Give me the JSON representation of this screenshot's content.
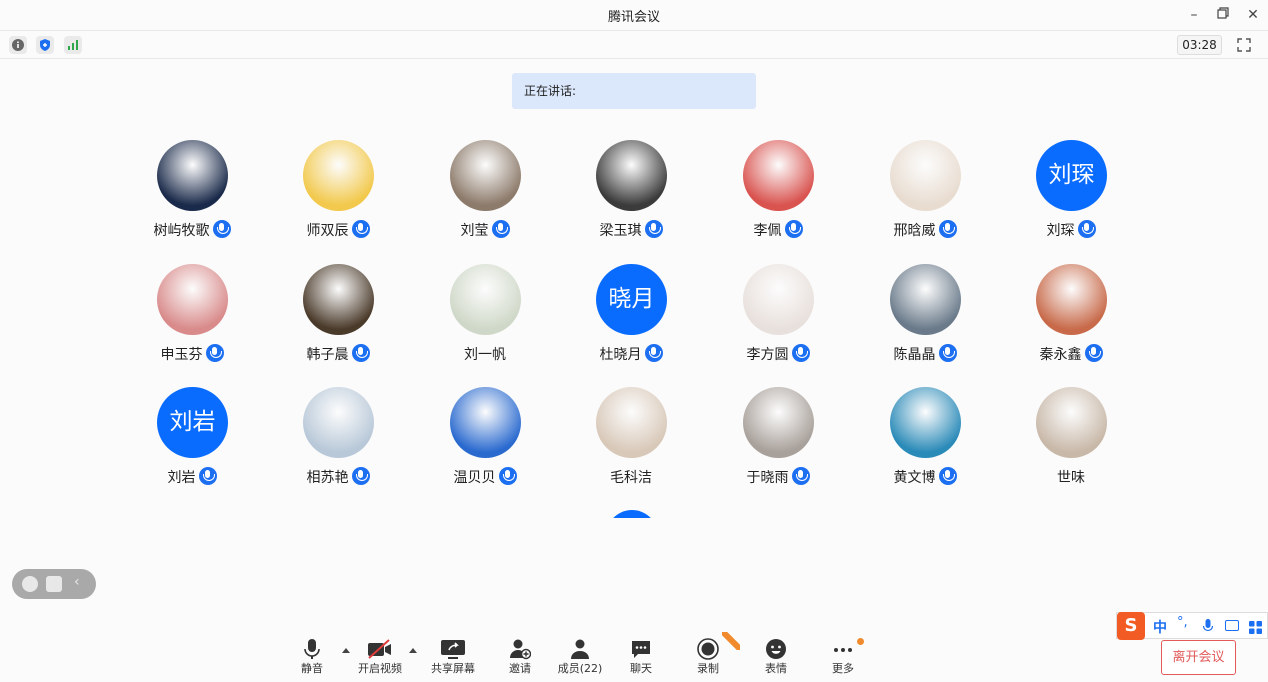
{
  "window": {
    "title": "腾讯会议"
  },
  "toolbar": {
    "timer": "03:28"
  },
  "speaking": {
    "label": "正在讲话:"
  },
  "colors": {
    "accent": "#0a6cff",
    "leave": "#e25a5a",
    "mic": "#1d6ff2"
  },
  "members": [
    {
      "name": "树屿牧歌",
      "avatar_text": "",
      "mic": true,
      "avatar_color": "#1a2a4a"
    },
    {
      "name": "师双辰",
      "avatar_text": "",
      "mic": true,
      "avatar_color": "#f2c94c"
    },
    {
      "name": "刘莹",
      "avatar_text": "",
      "mic": true,
      "avatar_color": "#8c7a6a"
    },
    {
      "name": "梁玉琪",
      "avatar_text": "",
      "mic": true,
      "avatar_color": "#3b3b3b"
    },
    {
      "name": "李佩",
      "avatar_text": "",
      "mic": true,
      "avatar_color": "#d9534f"
    },
    {
      "name": "邢晗威",
      "avatar_text": "",
      "mic": true,
      "avatar_color": "#e8dcd0"
    },
    {
      "name": "刘琛",
      "avatar_text": "刘琛",
      "mic": true,
      "avatar_color": "#0a6cff"
    },
    {
      "name": "申玉芬",
      "avatar_text": "",
      "mic": true,
      "avatar_color": "#d98a8a"
    },
    {
      "name": "韩子晨",
      "avatar_text": "",
      "mic": true,
      "avatar_color": "#4a3a2a"
    },
    {
      "name": "刘一帆",
      "avatar_text": "",
      "mic": false,
      "avatar_color": "#cfd8c8"
    },
    {
      "name": "杜晓月",
      "avatar_text": "晓月",
      "mic": true,
      "avatar_color": "#0a6cff"
    },
    {
      "name": "李方圆",
      "avatar_text": "",
      "mic": true,
      "avatar_color": "#e8e0dc"
    },
    {
      "name": "陈晶晶",
      "avatar_text": "",
      "mic": true,
      "avatar_color": "#6a7a8a"
    },
    {
      "name": "秦永鑫",
      "avatar_text": "",
      "mic": true,
      "avatar_color": "#c86a4a"
    },
    {
      "name": "刘岩",
      "avatar_text": "刘岩",
      "mic": true,
      "avatar_color": "#0a6cff"
    },
    {
      "name": "相苏艳",
      "avatar_text": "",
      "mic": true,
      "avatar_color": "#b8c8d8"
    },
    {
      "name": "温贝贝",
      "avatar_text": "",
      "mic": true,
      "avatar_color": "#2a6acf"
    },
    {
      "name": "毛科洁",
      "avatar_text": "",
      "mic": false,
      "avatar_color": "#d8c8b8"
    },
    {
      "name": "于晓雨",
      "avatar_text": "",
      "mic": true,
      "avatar_color": "#a8a09a"
    },
    {
      "name": "黄文博",
      "avatar_text": "",
      "mic": true,
      "avatar_color": "#2a8ab8"
    },
    {
      "name": "世味",
      "avatar_text": "",
      "mic": false,
      "avatar_color": "#c8b8a8"
    }
  ],
  "bottombar": {
    "mute": "静音",
    "video": "开启视频",
    "share": "共享屏幕",
    "invite": "邀请",
    "members": "成员(22)",
    "chat": "聊天",
    "record": "录制",
    "emoji": "表情",
    "more": "更多",
    "leave": "离开会议"
  },
  "ime": {
    "lang": "中"
  }
}
